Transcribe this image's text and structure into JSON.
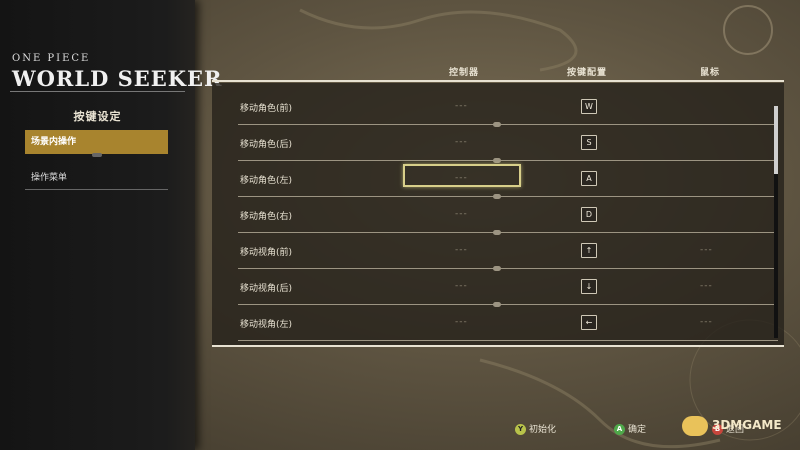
{
  "logo": {
    "small": "ONE PIECE",
    "big": "WORLD SEEKER"
  },
  "sidebar": {
    "title": "按键设定",
    "items": [
      {
        "label": "场景内操作",
        "active": true
      },
      {
        "label": "操作菜单",
        "active": false
      }
    ]
  },
  "columns": {
    "controller": "控制器",
    "keyboard": "按键配置",
    "mouse": "鼠标"
  },
  "rows": [
    {
      "label": "移动角色(前)",
      "controller": "---",
      "key": "W",
      "mouse": ""
    },
    {
      "label": "移动角色(后)",
      "controller": "---",
      "key": "S",
      "mouse": ""
    },
    {
      "label": "移动角色(左)",
      "controller": "---",
      "key": "A",
      "mouse": ""
    },
    {
      "label": "移动角色(右)",
      "controller": "---",
      "key": "D",
      "mouse": ""
    },
    {
      "label": "移动视角(前)",
      "controller": "---",
      "key": "↑",
      "mouse": "---"
    },
    {
      "label": "移动视角(后)",
      "controller": "---",
      "key": "↓",
      "mouse": "---"
    },
    {
      "label": "移动视角(左)",
      "controller": "---",
      "key": "←",
      "mouse": "---"
    }
  ],
  "footer": {
    "reset": {
      "button": "Y",
      "label": "初始化",
      "color": "#b8c24a"
    },
    "confirm": {
      "button": "A",
      "label": "确定",
      "color": "#4fa84a"
    },
    "back": {
      "button": "B",
      "label": "返回",
      "color": "#c8463c"
    }
  },
  "watermark": "3DMGAME",
  "colors": {
    "accent": "#a8842e",
    "panel": "#141414"
  }
}
